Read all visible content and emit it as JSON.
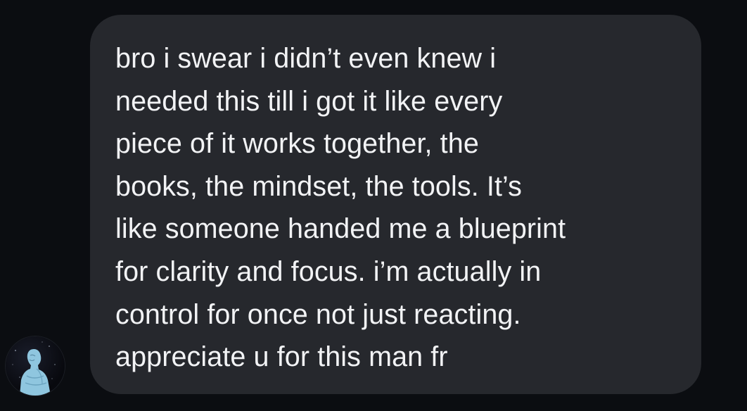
{
  "message": {
    "text": "bro i swear i didn’t even knew i\nneeded this till i got it like every\npiece of it works together, the\nbooks, the mindset, the tools. It’s\nlike someone handed me a blueprint\nfor clarity and focus. i’m actually in\ncontrol for once not just reacting.\nappreciate u for this man fr"
  },
  "sender": {
    "avatar_icon": "statue-figure-avatar-icon"
  },
  "colors": {
    "background": "#0b0d11",
    "bubble": "#26282d",
    "text": "#f2f3f5",
    "avatar_figure": "#9fd0e6"
  }
}
